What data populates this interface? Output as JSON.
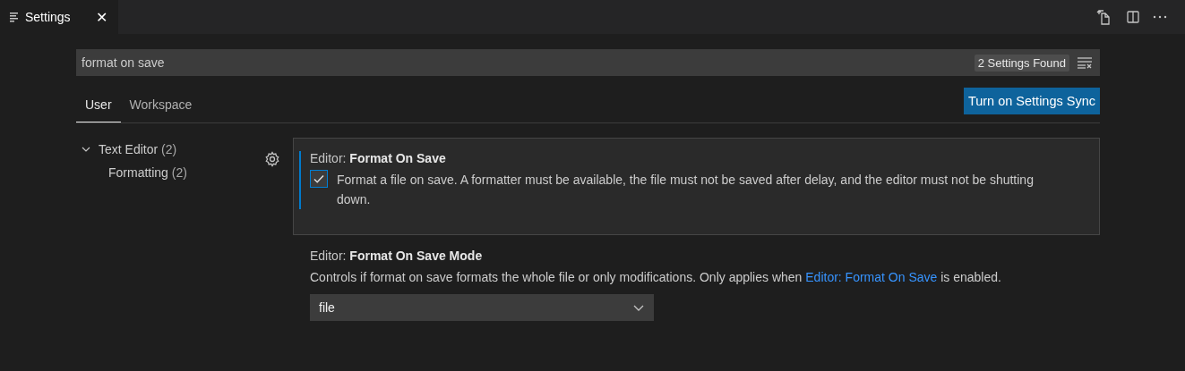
{
  "editor_tab": {
    "title": "Settings",
    "close": "✕"
  },
  "search": {
    "value": "format on save",
    "result_count": "2 Settings Found"
  },
  "scope_tabs": [
    {
      "label": "User",
      "selected": true
    },
    {
      "label": "Workspace",
      "selected": false
    }
  ],
  "sync_button": "Turn on Settings Sync",
  "toc": [
    {
      "label": "Text Editor",
      "count": "(2)",
      "expanded": true,
      "children": [
        {
          "label": "Formatting",
          "count": "(2)"
        }
      ]
    }
  ],
  "settings": [
    {
      "kind": "checkbox",
      "focused": true,
      "category": "Editor:",
      "name": "Format On Save",
      "checked": true,
      "description": "Format a file on save. A formatter must be available, the file must not be saved after delay, and the editor must not be shutting down."
    },
    {
      "kind": "dropdown",
      "focused": false,
      "category": "Editor:",
      "name": "Format On Save Mode",
      "description_before": "Controls if format on save formats the whole file or only modifications. Only applies when",
      "link": "Editor: Format On Save",
      "description_after": "is enabled.",
      "value": "file"
    }
  ]
}
